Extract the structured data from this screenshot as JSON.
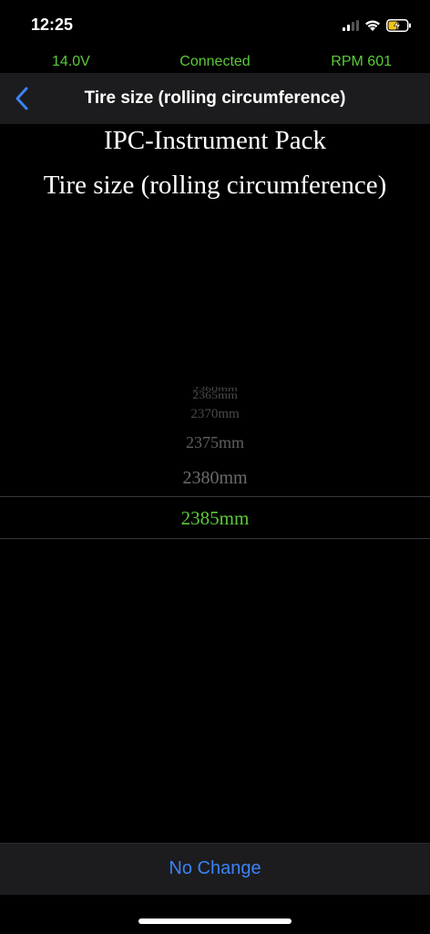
{
  "status_bar": {
    "time": "12:25",
    "icons": [
      "cellular-signal-icon",
      "wifi-icon",
      "battery-charging-icon"
    ]
  },
  "info_bar": {
    "voltage": "14.0V",
    "connection": "Connected",
    "rpm": "RPM 601",
    "color": "#5cc93a"
  },
  "nav": {
    "title": "Tire size (rolling circumference)",
    "back_icon": "chevron-left-icon",
    "accent": "#3b82f6"
  },
  "headings": {
    "device": "IPC-Instrument Pack",
    "setting": "Tire size (rolling circumference)"
  },
  "picker": {
    "options": [
      "2360mm",
      "2365mm",
      "2370mm",
      "2375mm",
      "2380mm"
    ],
    "selected": "2385mm",
    "selected_color": "#5cc93a"
  },
  "footer": {
    "no_change_label": "No Change"
  }
}
